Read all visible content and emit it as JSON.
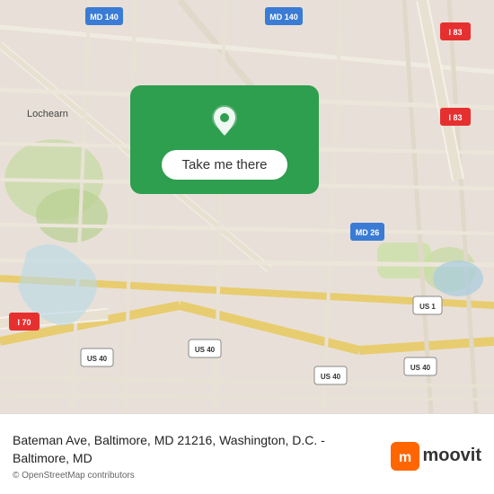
{
  "map": {
    "alt": "Map of Bateman Ave, Baltimore, MD 21216 area"
  },
  "cta": {
    "button_label": "Take me there"
  },
  "footer": {
    "address": "Bateman Ave, Baltimore, MD 21216, Washington, D.C. - Baltimore, MD",
    "osm_credit": "© OpenStreetMap contributors"
  },
  "branding": {
    "logo_text": "moovit",
    "logo_dot_color": "#e55"
  },
  "road_labels": {
    "md140_top_left": "MD 140",
    "md140_top_right": "MD 140",
    "i83_top_right1": "I 83",
    "i83_top_right2": "I 83",
    "i70": "I 70",
    "md26": "MD 26",
    "us40_left": "US 40",
    "us40_center": "US 40",
    "us40_right1": "US 40",
    "us40_right2": "US 40",
    "us1": "US 1",
    "lochearn": "Lochearn"
  }
}
